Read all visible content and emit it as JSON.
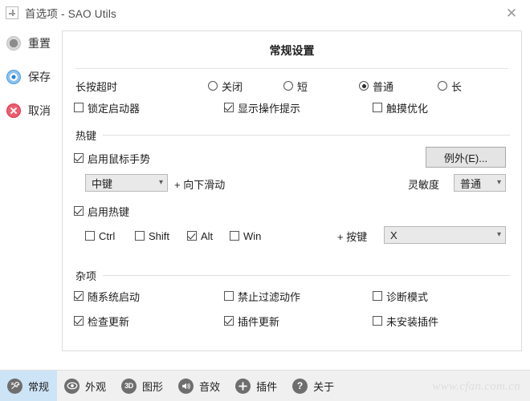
{
  "window": {
    "title": "首选项 - SAO Utils",
    "icon": "plus-box-icon",
    "close_label": "✕"
  },
  "sidebar": {
    "items": [
      {
        "label": "重置",
        "icon": "reset-circle-icon"
      },
      {
        "label": "保存",
        "icon": "save-circle-icon"
      },
      {
        "label": "取消",
        "icon": "cancel-circle-icon"
      }
    ]
  },
  "panel": {
    "title": "常规设置",
    "longpress": {
      "label": "长按超时",
      "options": [
        {
          "label": "关闭",
          "selected": false
        },
        {
          "label": "短",
          "selected": false
        },
        {
          "label": "普通",
          "selected": true
        },
        {
          "label": "长",
          "selected": false
        }
      ]
    },
    "toggles_row": [
      {
        "label": "锁定启动器",
        "checked": false
      },
      {
        "label": "显示操作提示",
        "checked": true
      },
      {
        "label": "触摸优化",
        "checked": false
      }
    ],
    "hotkey_group": {
      "title": "热键",
      "gesture_enable": {
        "label": "启用鼠标手势",
        "checked": true
      },
      "exception_button": "例外(E)...",
      "gesture_button_combo": {
        "value": "中键"
      },
      "gesture_direction": "+ 向下滑动",
      "sensitivity_label": "灵敏度",
      "sensitivity_combo": {
        "value": "普通"
      },
      "hotkey_enable": {
        "label": "启用热键",
        "checked": true
      },
      "modifiers": [
        {
          "label": "Ctrl",
          "checked": false
        },
        {
          "label": "Shift",
          "checked": false
        },
        {
          "label": "Alt",
          "checked": true
        },
        {
          "label": "Win",
          "checked": false
        }
      ],
      "key_label": "+ 按键",
      "key_combo": {
        "value": "X"
      }
    },
    "misc_group": {
      "title": "杂项",
      "items": [
        {
          "label": "随系统启动",
          "checked": true
        },
        {
          "label": "禁止过滤动作",
          "checked": false
        },
        {
          "label": "诊断模式",
          "checked": false
        },
        {
          "label": "检查更新",
          "checked": true
        },
        {
          "label": "插件更新",
          "checked": true
        },
        {
          "label": "未安装插件",
          "checked": false
        }
      ]
    }
  },
  "tabs": [
    {
      "label": "常规",
      "icon": "wrench-icon",
      "active": true
    },
    {
      "label": "外观",
      "icon": "eye-icon",
      "active": false
    },
    {
      "label": "图形",
      "icon": "3d-icon",
      "active": false
    },
    {
      "label": "音效",
      "icon": "speaker-icon",
      "active": false
    },
    {
      "label": "插件",
      "icon": "plus-icon",
      "active": false
    },
    {
      "label": "关于",
      "icon": "question-icon",
      "active": false
    }
  ],
  "watermark": "www.cfan.com.cn"
}
